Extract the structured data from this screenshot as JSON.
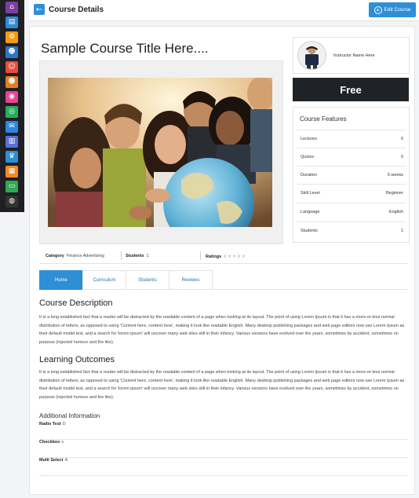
{
  "header": {
    "title": "Course Details",
    "edit_label": "Edit Course",
    "back_icon": "←",
    "edit_icon": "+"
  },
  "sidebar": {
    "items": [
      {
        "name": "home-icon",
        "color": "#7b3fa0",
        "glyph": "⌂"
      },
      {
        "name": "book-icon",
        "color": "#2e8bd8",
        "glyph": "▤"
      },
      {
        "name": "gear-icon",
        "color": "#f39c12",
        "glyph": "⚙"
      },
      {
        "name": "users-icon",
        "color": "#2e75c8",
        "glyph": "☻"
      },
      {
        "name": "user-icon",
        "color": "#e74c3c",
        "glyph": "☺"
      },
      {
        "name": "group-icon",
        "color": "#e67e22",
        "glyph": "☻"
      },
      {
        "name": "camera-icon",
        "color": "#e84393",
        "glyph": "◉"
      },
      {
        "name": "coins-icon",
        "color": "#27ae60",
        "glyph": "◎"
      },
      {
        "name": "mail-icon",
        "color": "#2e86de",
        "glyph": "✉"
      },
      {
        "name": "chart-icon",
        "color": "#5b6fd8",
        "glyph": "▥"
      },
      {
        "name": "trophy-icon",
        "color": "#2c8fd6",
        "glyph": "♛"
      },
      {
        "name": "calc-icon",
        "color": "#f08a24",
        "glyph": "▦"
      },
      {
        "name": "print-icon",
        "color": "#2eaa4f",
        "glyph": "▭"
      },
      {
        "name": "globe-icon",
        "color": "#333333",
        "glyph": "◍"
      }
    ]
  },
  "course": {
    "title": "Sample Course Title Here...."
  },
  "instructor": {
    "name": "Instructor Name Here"
  },
  "price": "Free",
  "features": {
    "heading": "Course Features",
    "rows": [
      {
        "label": "Lectures",
        "value": "0"
      },
      {
        "label": "Quizes",
        "value": "0"
      },
      {
        "label": "Duration",
        "value": "5 weeks"
      },
      {
        "label": "Skill Level",
        "value": "Beginner"
      },
      {
        "label": "Language",
        "value": "English"
      },
      {
        "label": "Students",
        "value": "1"
      }
    ]
  },
  "meta": {
    "category_label": "Category",
    "category_value": "Finance Advertising",
    "students_label": "Students",
    "students_value": "1",
    "ratings_label": "Ratings",
    "stars": "★★★★★",
    "rating_value": 0
  },
  "tabs": [
    {
      "label": "Home",
      "active": true
    },
    {
      "label": "Curriculum",
      "active": false
    },
    {
      "label": "Students",
      "active": false
    },
    {
      "label": "Reviews",
      "active": false
    }
  ],
  "description": {
    "heading": "Course Description",
    "text": "It is a long established fact that a reader will be distracted by the readable content of a page when looking at its layout. The point of using Lorem Ipsum is that it has a more-or-less normal distribution of letters, as opposed to using 'Content here, content here', making it look like readable English. Many desktop publishing packages and web page editors now use Lorem Ipsum as their default model text, and a search for 'lorem ipsum' will uncover many web sites still in their infancy. Various versions have evolved over the years, sometimes by accident, sometimes on purpose (injected humour and the like)."
  },
  "outcomes": {
    "heading": "Learning Outcomes",
    "text": "It is a long established fact that a reader will be distracted by the readable content of a page when looking at its layout. The point of using Lorem Ipsum is that it has a more-or-less normal distribution of letters, as opposed to using 'Content here, content here', making it look like readable English. Many desktop publishing packages and web page editors now use Lorem Ipsum as their default model text, and a search for 'lorem ipsum' will uncover many web sites still in their infancy. Various versions have evolved over the years, sometimes by accident, sometimes on purpose (injected humour and the like)."
  },
  "additional": {
    "heading": "Additional Information",
    "rows": [
      {
        "label": "Radio Test",
        "value": "D"
      },
      {
        "label": "Checkbox",
        "value": "s"
      },
      {
        "label": "Multi Select",
        "value": "A"
      }
    ]
  },
  "colors": {
    "accent": "#2f8fd6",
    "price_bg": "#1f2328"
  }
}
